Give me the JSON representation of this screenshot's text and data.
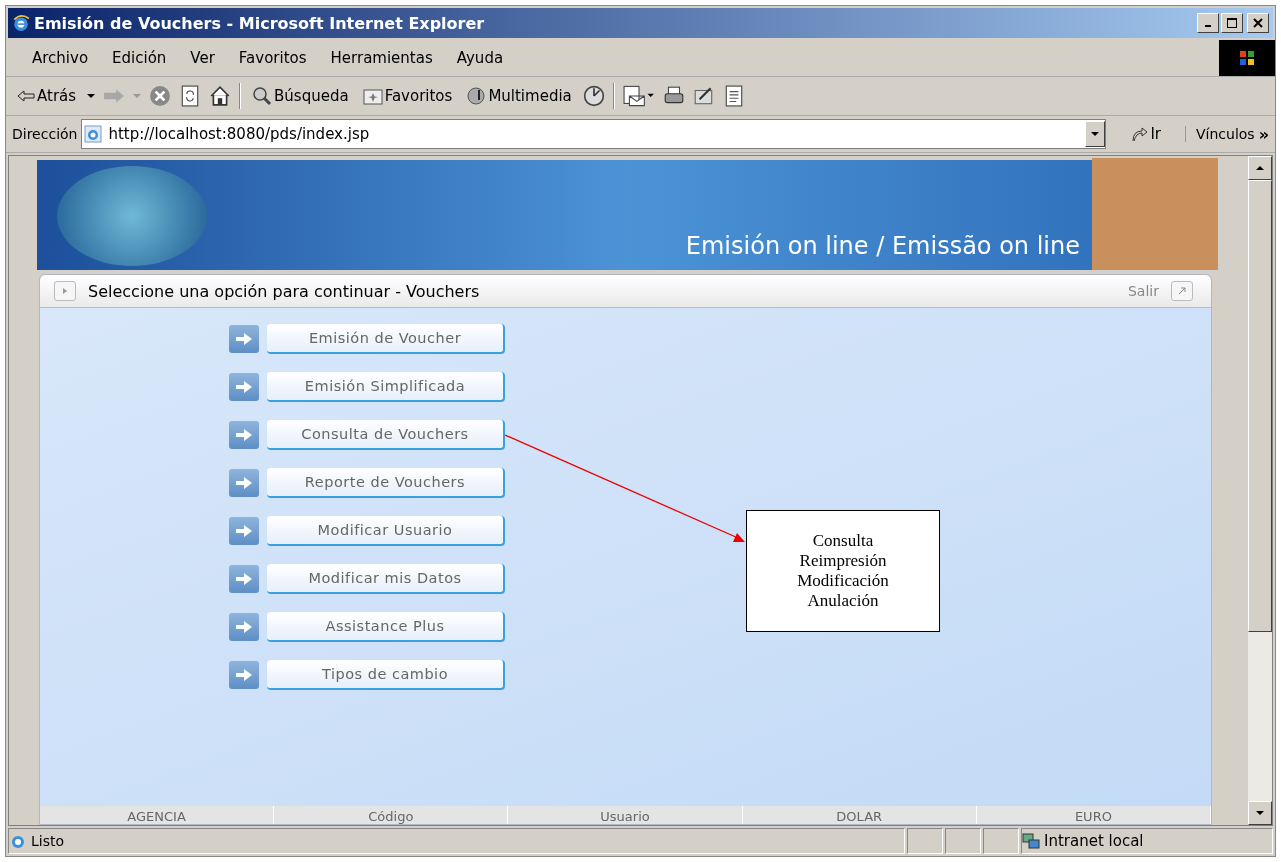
{
  "window": {
    "title": "Emisión de Vouchers - Microsoft Internet Explorer"
  },
  "menu": [
    "Archivo",
    "Edición",
    "Ver",
    "Favoritos",
    "Herramientas",
    "Ayuda"
  ],
  "toolbar": {
    "back": "Atrás",
    "search": "Búsqueda",
    "favorites": "Favoritos",
    "media": "Multimedia"
  },
  "address": {
    "label": "Dirección",
    "value": "http://localhost:8080/pds/index.jsp",
    "go": "Ir",
    "links": "Vínculos",
    "more": "»"
  },
  "banner": {
    "title": "Emisión on line / Emissão on line"
  },
  "panel": {
    "title": "Seleccione una opción para continuar - Vouchers",
    "exit": "Salir"
  },
  "options": [
    "Emisión de Voucher",
    "Emisión Simplificada",
    "Consulta de Vouchers",
    "Reporte de Vouchers",
    "Modificar Usuario",
    "Modificar mis Datos",
    "Assistance Plus",
    "Tipos de cambio"
  ],
  "footer_columns": [
    "AGENCIA",
    "Código",
    "Usuario",
    "DOLAR",
    "EURO"
  ],
  "annotation": {
    "lines": [
      "Consulta",
      "Reimpresión",
      "Modificación",
      "Anulación"
    ]
  },
  "status_bar": {
    "text": "Listo",
    "zone": "Intranet local"
  }
}
